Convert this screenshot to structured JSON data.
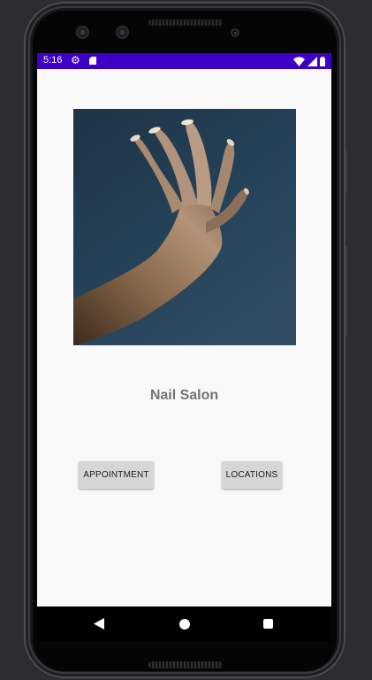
{
  "status_bar": {
    "time": "5:16",
    "icons": [
      "gear-icon",
      "sd-card-icon",
      "wifi-icon",
      "signal-icon",
      "battery-icon"
    ],
    "background_color": "#3d00c4"
  },
  "main": {
    "image_description_name": "hand-with-manicured-nails-photo",
    "title": "Nail Salon",
    "buttons": {
      "appointment_label": "APPOINTMENT",
      "locations_label": "LOCATIONS"
    }
  },
  "nav_bar": {
    "icons": [
      "back-icon",
      "home-icon",
      "recents-icon"
    ]
  },
  "colors": {
    "screen_background": "#f9f9f9",
    "title_text": "#737373",
    "button_background": "#d6d6d6"
  }
}
